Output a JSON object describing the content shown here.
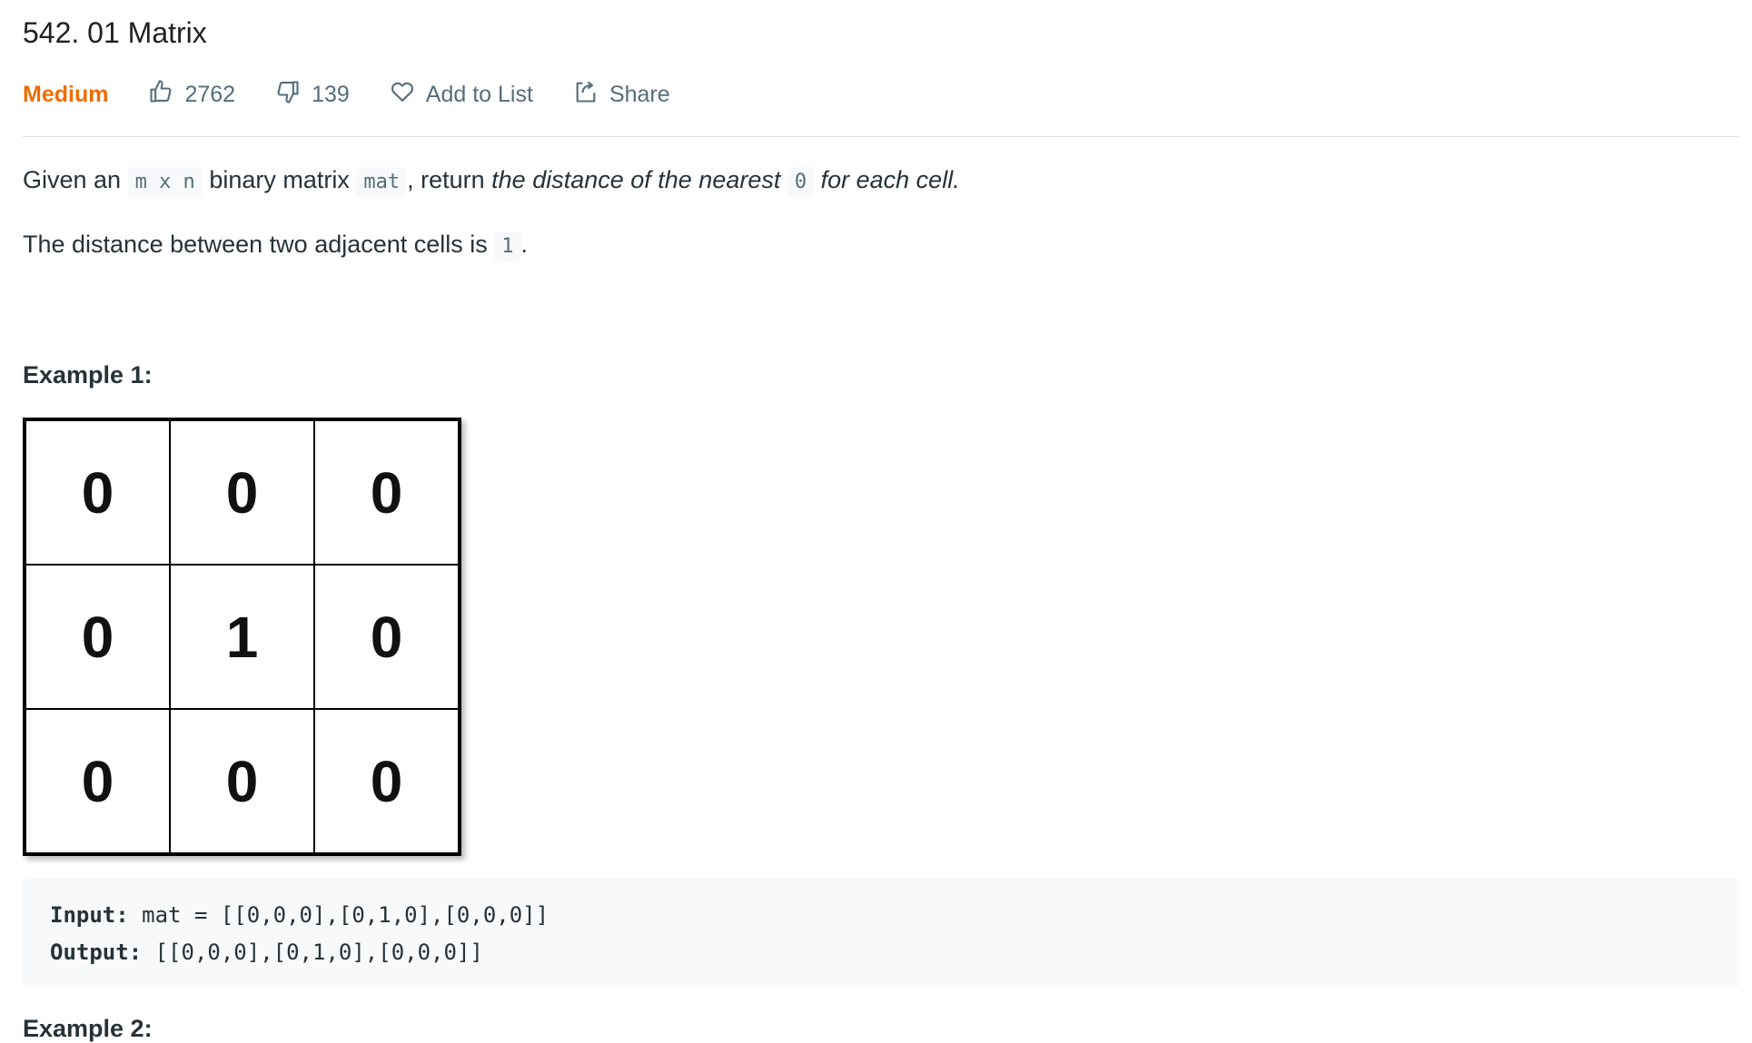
{
  "problem": {
    "title": "542. 01 Matrix",
    "difficulty": "Medium",
    "likes": "2762",
    "dislikes": "139",
    "add_to_list": "Add to List",
    "share": "Share"
  },
  "description": {
    "p1_prefix": "Given an ",
    "p1_code1": "m x n",
    "p1_mid": " binary matrix ",
    "p1_code2": "mat",
    "p1_sep": ", return ",
    "p1_em1": "the distance of the nearest ",
    "p1_code3": "0",
    "p1_em2": " for each cell",
    "p1_period": ".",
    "p2_text": "The distance between two adjacent cells is ",
    "p2_code": "1",
    "p2_period": "."
  },
  "example1": {
    "title": "Example 1:",
    "matrix": [
      [
        "0",
        "0",
        "0"
      ],
      [
        "0",
        "1",
        "0"
      ],
      [
        "0",
        "0",
        "0"
      ]
    ],
    "input_label": "Input:",
    "input_value": " mat = [[0,0,0],[0,1,0],[0,0,0]]",
    "output_label": "Output:",
    "output_value": " [[0,0,0],[0,1,0],[0,0,0]]"
  },
  "example2": {
    "title": "Example 2:"
  },
  "colors": {
    "difficulty_medium": "#ef6c00",
    "text": "#263238",
    "muted": "#546e7a",
    "code_bg": "#f7f9fa"
  },
  "icons": [
    "thumbs-up-icon",
    "thumbs-down-icon",
    "heart-icon",
    "share-icon"
  ]
}
